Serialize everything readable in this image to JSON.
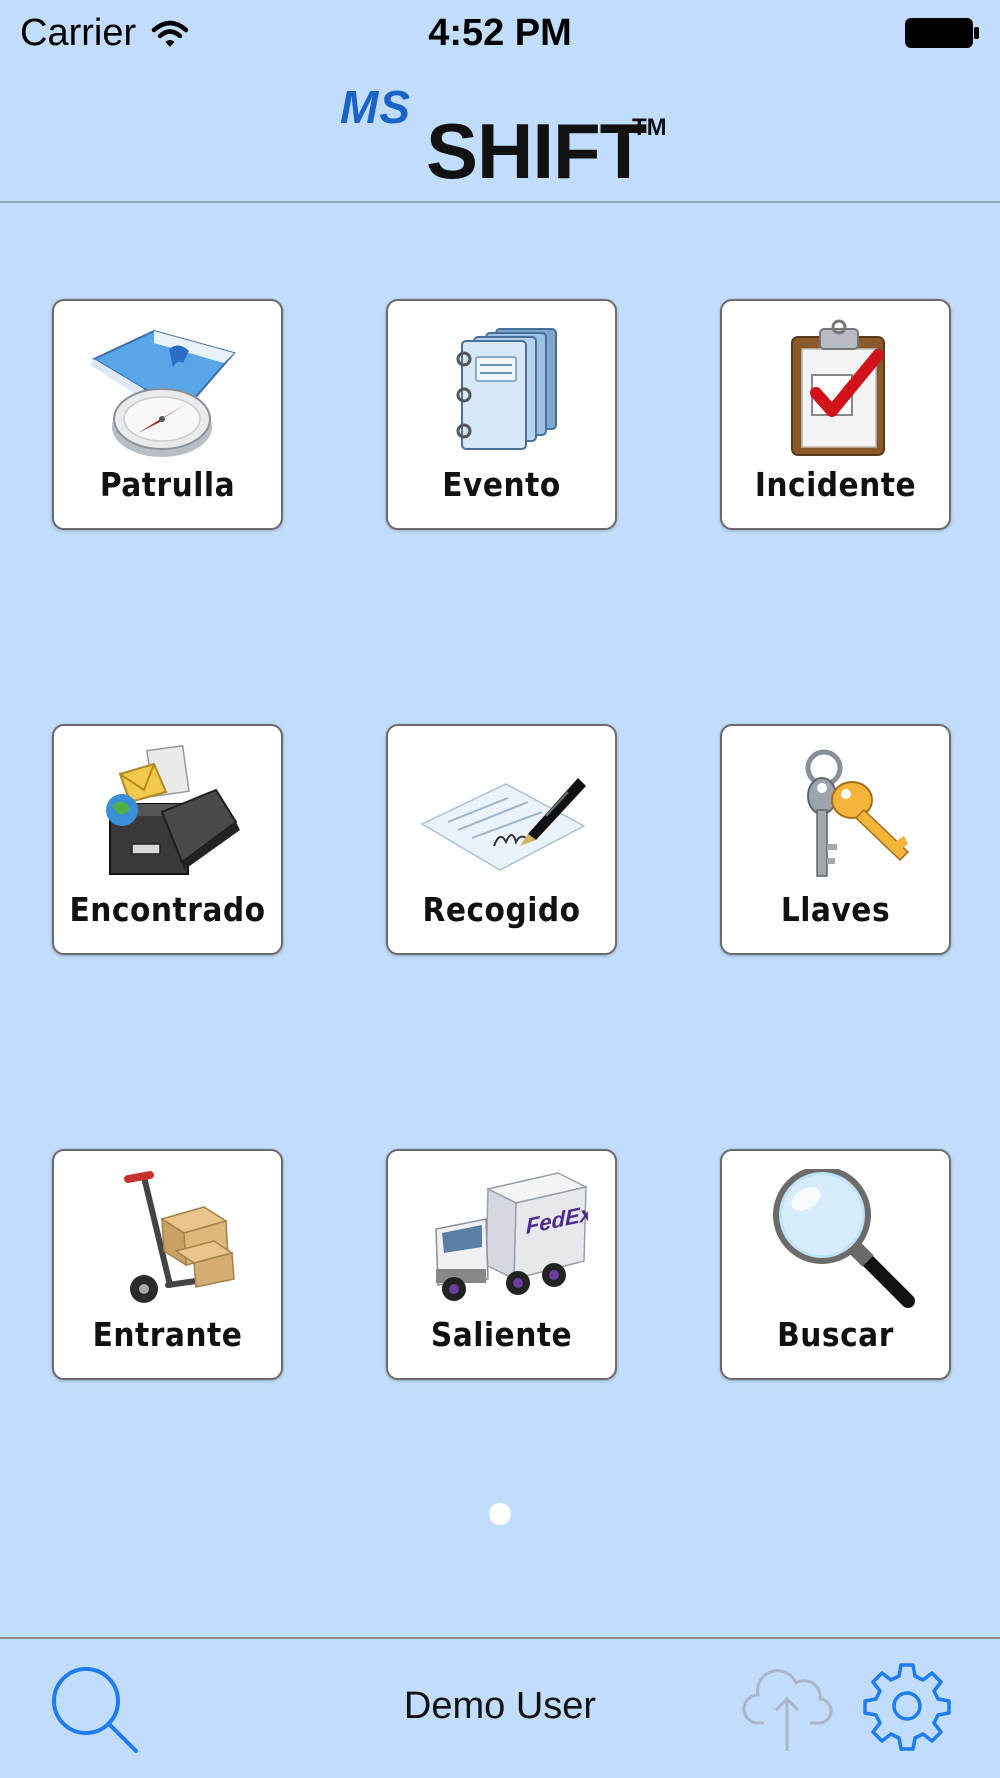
{
  "status_bar": {
    "carrier": "Carrier",
    "time": "4:52 PM"
  },
  "header": {
    "logo_ms": "MS",
    "logo_shift": "SHIFT",
    "logo_tm": "TM"
  },
  "tiles": [
    {
      "label": "Patrulla",
      "icon": "map-compass-icon"
    },
    {
      "label": "Evento",
      "icon": "notebook-icon"
    },
    {
      "label": "Incidente",
      "icon": "clipboard-check-icon"
    },
    {
      "label": "Encontrado",
      "icon": "drawer-box-icon"
    },
    {
      "label": "Recogido",
      "icon": "pen-signature-icon"
    },
    {
      "label": "Llaves",
      "icon": "keys-icon"
    },
    {
      "label": "Entrante",
      "icon": "hand-truck-icon"
    },
    {
      "label": "Saliente",
      "icon": "delivery-truck-icon"
    },
    {
      "label": "Buscar",
      "icon": "magnifier-icon"
    }
  ],
  "truck_brand": "FedEx",
  "pagination": {
    "current": 1,
    "total": 1
  },
  "toolbar": {
    "user": "Demo User"
  },
  "colors": {
    "background": "#c2ddfb",
    "accent": "#1e7cf0",
    "disabled": "#a9b6c6"
  }
}
